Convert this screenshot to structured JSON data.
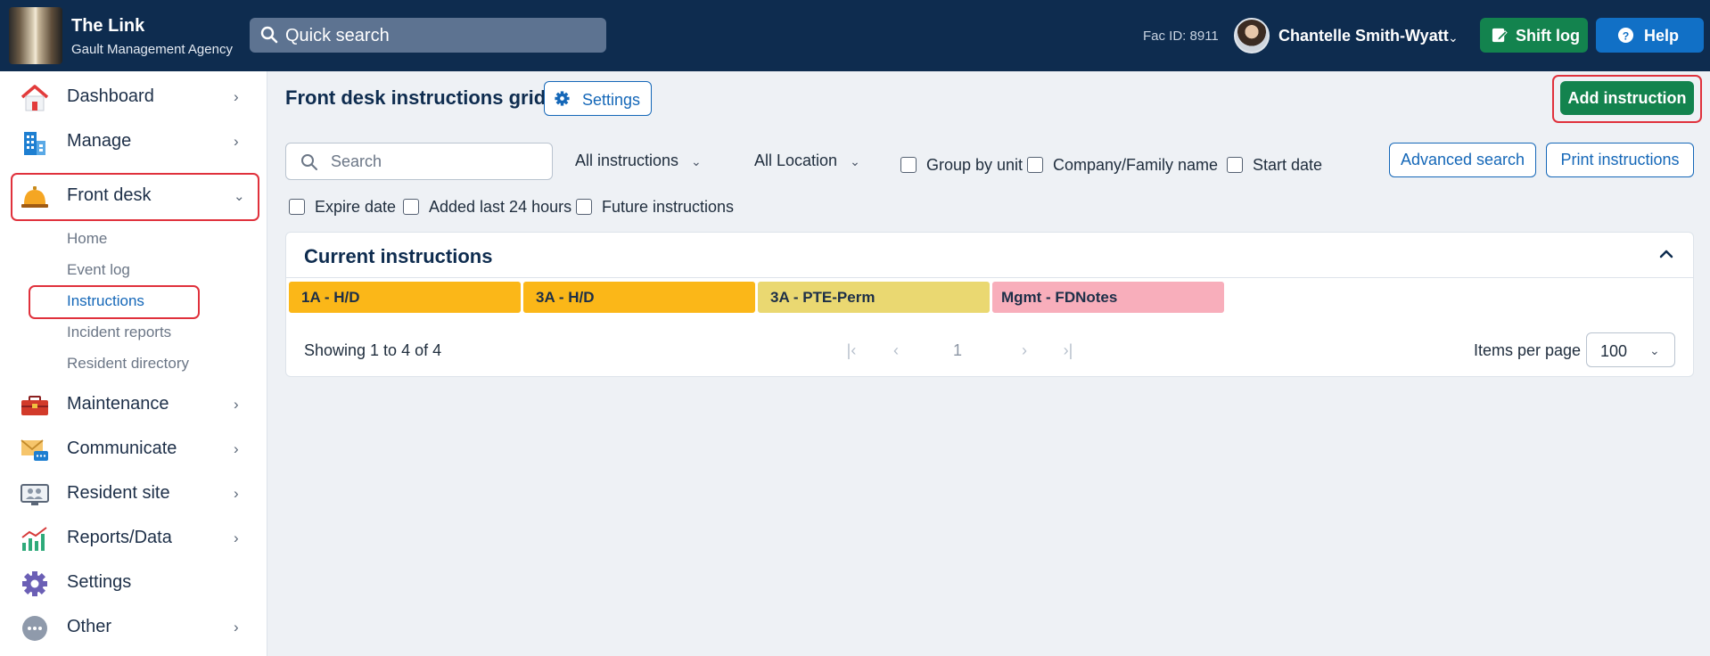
{
  "header": {
    "app_title": "The Link",
    "agency": "Gault Management Agency",
    "quick_search_label": "Quick search",
    "fac_id": "Fac ID: 8911",
    "user_name": "Chantelle Smith-Wyatt",
    "shift_log_label": "Shift log",
    "help_label": "Help"
  },
  "sidebar": {
    "items": [
      {
        "label": "Dashboard",
        "icon": "house-icon"
      },
      {
        "label": "Manage",
        "icon": "building-icon"
      },
      {
        "label": "Front desk",
        "icon": "service-bell-icon"
      },
      {
        "label": "Maintenance",
        "icon": "toolbox-icon"
      },
      {
        "label": "Communicate",
        "icon": "envelope-chat-icon"
      },
      {
        "label": "Resident site",
        "icon": "monitor-people-icon"
      },
      {
        "label": "Reports/Data",
        "icon": "bar-chart-icon"
      },
      {
        "label": "Settings",
        "icon": "gear-icon"
      },
      {
        "label": "Other",
        "icon": "more-dots-icon"
      }
    ],
    "front_desk_sub": [
      "Home",
      "Event log",
      "Instructions",
      "Incident reports",
      "Resident directory"
    ]
  },
  "main": {
    "title": "Front desk instructions grid",
    "settings_label": "Settings",
    "add_label": "Add instruction",
    "search_placeholder": "Search",
    "filter_instructions": "All instructions",
    "filter_location": "All Location",
    "checks": [
      "Group by unit",
      "Company/Family name",
      "Start date",
      "Expire date",
      "Added last 24 hours",
      "Future instructions"
    ],
    "advanced_search_label": "Advanced search",
    "print_label": "Print instructions",
    "panel_title": "Current instructions",
    "tags": [
      {
        "label": "1A - H/D",
        "color": "#fbb718"
      },
      {
        "label": "3A - H/D",
        "color": "#fbb718"
      },
      {
        "label": "3A - PTE-Perm",
        "color": "#ead871"
      },
      {
        "label": "Mgmt - FDNotes",
        "color": "#f8aebb"
      }
    ],
    "showing": "Showing 1 to 4 of 4",
    "current_page": "1",
    "items_per_page_label": "Items per page",
    "items_per_page": "100"
  },
  "colors": {
    "header_bg": "#0e2c4f",
    "primary_green": "#13834e",
    "primary_blue": "#1467b8",
    "highlight_red": "#e0313c"
  }
}
